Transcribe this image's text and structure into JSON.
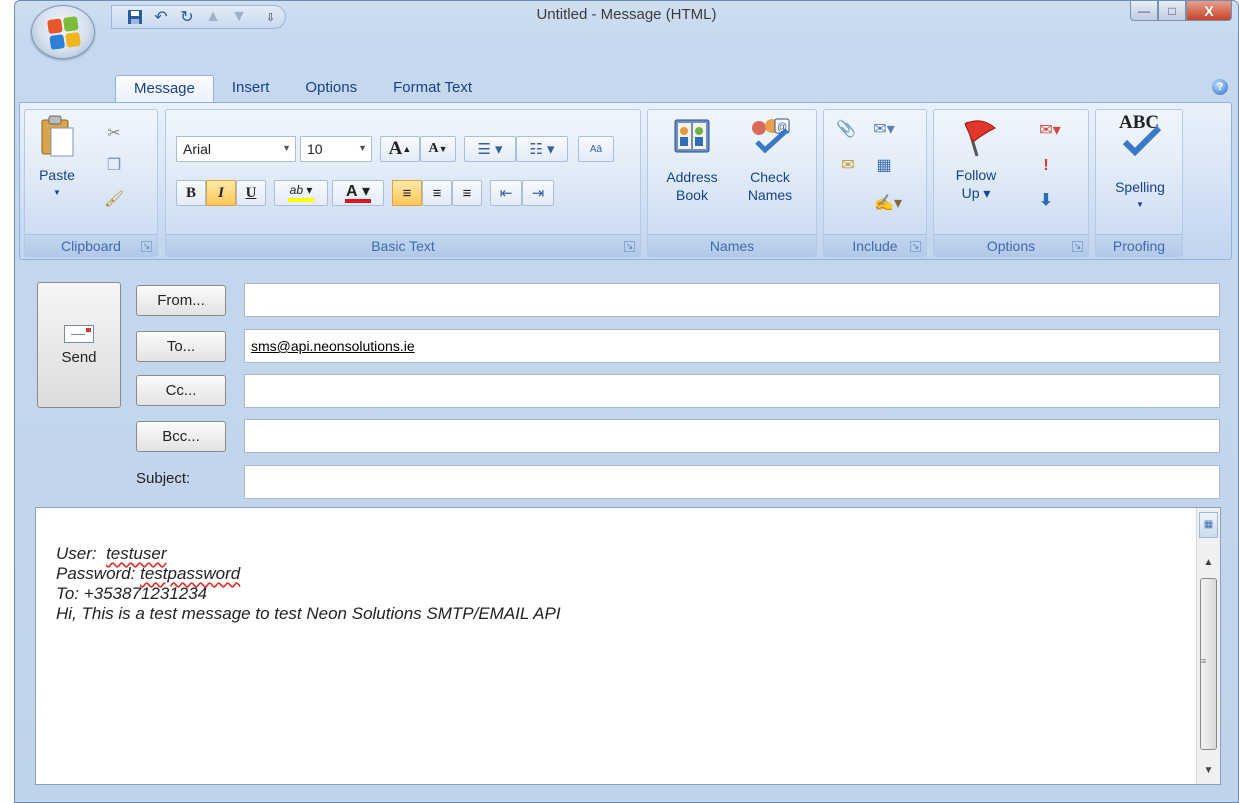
{
  "window": {
    "title": "Untitled - Message (HTML)",
    "controls": {
      "minimize": "—",
      "maximize": "□",
      "close": "X"
    }
  },
  "quick_access": {
    "dropdown": "⇩"
  },
  "tabs": [
    {
      "label": "Message"
    },
    {
      "label": "Insert"
    },
    {
      "label": "Options"
    },
    {
      "label": "Format Text"
    }
  ],
  "ribbon": {
    "groups": {
      "clipboard": "Clipboard",
      "basic_text": "Basic Text",
      "names": "Names",
      "include": "Include",
      "options": "Options",
      "proofing": "Proofing"
    },
    "paste_label": "Paste",
    "font_name": "Arial",
    "font_size": "10",
    "bold": "B",
    "italic": "I",
    "underline": "U",
    "address_book": "Address\nBook",
    "address_book_line1": "Address",
    "address_book_line2": "Book",
    "check_names_line1": "Check",
    "check_names_line2": "Names",
    "follow_up_line1": "Follow",
    "follow_up_line2": "Up",
    "spelling_label": "Spelling",
    "spelling_icon_text": "ABC",
    "grow_font": "A",
    "shrink_font": "A",
    "highlight_text": "ab",
    "font_color": "A"
  },
  "header": {
    "send_label": "Send",
    "from_label": "From...",
    "to_label": "To...",
    "cc_label": "Cc...",
    "bcc_label": "Bcc...",
    "subject_label": "Subject:",
    "from_value": "",
    "to_value": "sms@api.neonsolutions.ie",
    "cc_value": "",
    "bcc_value": "",
    "subject_value": ""
  },
  "message_body": {
    "line1_prefix": "User:  ",
    "line1_value": "testuser",
    "line2_prefix": "Password: ",
    "line2_value": "testpassword",
    "line3": "To: +353871231234",
    "line4": "Hi, This is a test message to test Neon Solutions SMTP/EMAIL API"
  },
  "colors": {
    "ribbon_text": "#15428b",
    "active_format": "#ffc857",
    "font_color_bar": "#e0141e",
    "highlight_bar": "#ffff00"
  }
}
